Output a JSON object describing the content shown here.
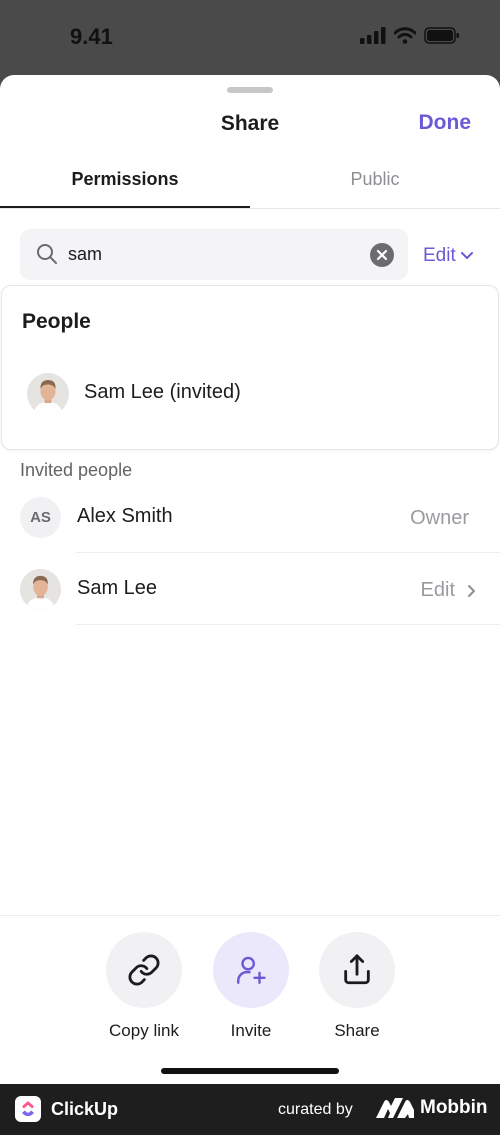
{
  "status_bar": {
    "time": "9.41"
  },
  "sheet": {
    "title": "Share",
    "done_label": "Done"
  },
  "tabs": [
    {
      "label": "Permissions",
      "selected": true
    },
    {
      "label": "Public",
      "selected": false
    }
  ],
  "search": {
    "value": "sam"
  },
  "permission_dropdown": {
    "label": "Edit"
  },
  "people_panel": {
    "title": "People",
    "results": [
      {
        "name": "Sam Lee (invited)",
        "avatar": "photo"
      }
    ]
  },
  "invited": {
    "header": "Invited people",
    "rows": [
      {
        "name": "Alex Smith",
        "initials": "AS",
        "role": "Owner"
      },
      {
        "name": "Sam Lee",
        "avatar": "photo",
        "role": "Edit"
      }
    ]
  },
  "actions": [
    {
      "label": "Copy link",
      "icon": "link-icon"
    },
    {
      "label": "Invite",
      "icon": "add-person-icon"
    },
    {
      "label": "Share",
      "icon": "share-icon"
    }
  ],
  "footer": {
    "app_name": "ClickUp",
    "curated_by": "curated by",
    "mobbin": "Mobbin"
  },
  "colors": {
    "accent": "#6b5ad6",
    "invite_bg": "#ece8fb"
  }
}
